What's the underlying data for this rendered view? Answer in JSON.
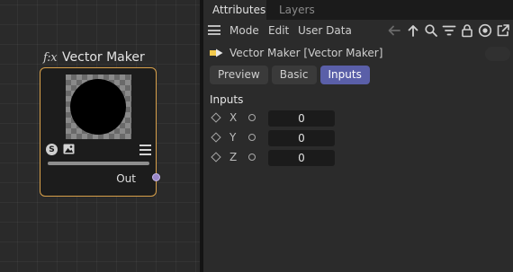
{
  "node_editor": {
    "node": {
      "fx_icon": "f:x",
      "title": "Vector Maker",
      "seed_icon_glyph": "S",
      "output_label": "Out"
    }
  },
  "attributes": {
    "tabs": [
      {
        "label": "Attributes",
        "active": true
      },
      {
        "label": "Layers",
        "active": false
      }
    ],
    "menu": {
      "mode": "Mode",
      "edit": "Edit",
      "user_data": "User Data"
    },
    "toolbar_icons": [
      "back-arrow-icon",
      "up-arrow-icon",
      "search-icon",
      "filter-icon",
      "lock-icon",
      "target-icon",
      "new-window-icon"
    ],
    "object_title": "Vector Maker [Vector Maker]",
    "mode_tabs": [
      {
        "label": "Preview",
        "active": false
      },
      {
        "label": "Basic",
        "active": false
      },
      {
        "label": "Inputs",
        "active": true
      }
    ],
    "group_label": "Inputs",
    "params": [
      {
        "label": "X",
        "value": "0"
      },
      {
        "label": "Y",
        "value": "0"
      },
      {
        "label": "Z",
        "value": "0"
      }
    ]
  },
  "colors": {
    "node_border": "#d8a04a",
    "active_tab": "#5a5fa8",
    "port": "#9a87c8"
  }
}
